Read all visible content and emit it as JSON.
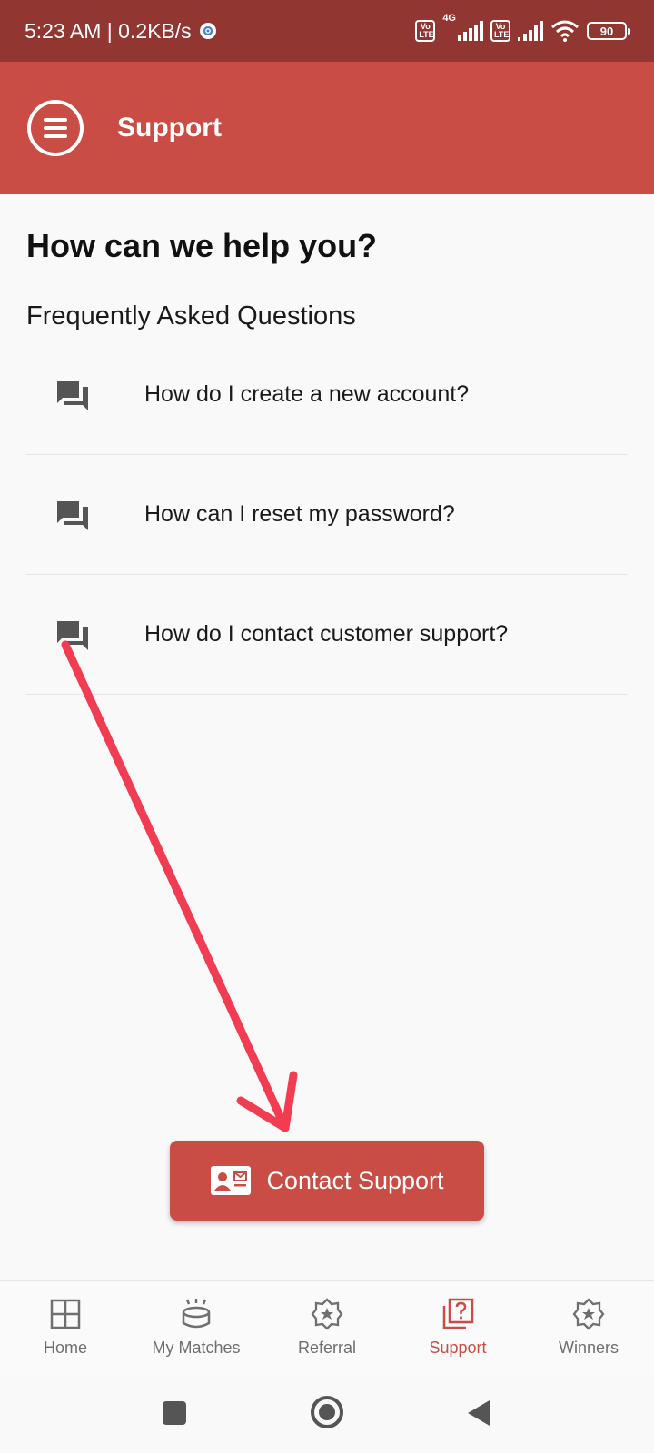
{
  "status_bar": {
    "time": "5:23 AM | 0.2KB/s",
    "volte_1": "Vo LTE",
    "network_type": "4G",
    "volte_2": "Vo LTE",
    "battery": "90"
  },
  "app_bar": {
    "title": "Support"
  },
  "main": {
    "heading": "How can we help you?",
    "faq_heading": "Frequently Asked Questions",
    "faqs": [
      {
        "question": "How do I create a new account?"
      },
      {
        "question": "How can I reset my password?"
      },
      {
        "question": "How do I contact customer support?"
      }
    ],
    "contact_button": "Contact Support"
  },
  "bottom_nav": {
    "items": [
      {
        "label": "Home",
        "icon": "grid-icon"
      },
      {
        "label": "My Matches",
        "icon": "stadium-icon"
      },
      {
        "label": "Referral",
        "icon": "star-badge-icon"
      },
      {
        "label": "Support",
        "icon": "question-icon"
      },
      {
        "label": "Winners",
        "icon": "star-badge-icon"
      }
    ],
    "active": "Support"
  },
  "colors": {
    "status_bar": "#923632",
    "primary": "#c94d45",
    "annotation_arrow": "#f23c52",
    "inactive_nav": "#6f6f6f"
  }
}
